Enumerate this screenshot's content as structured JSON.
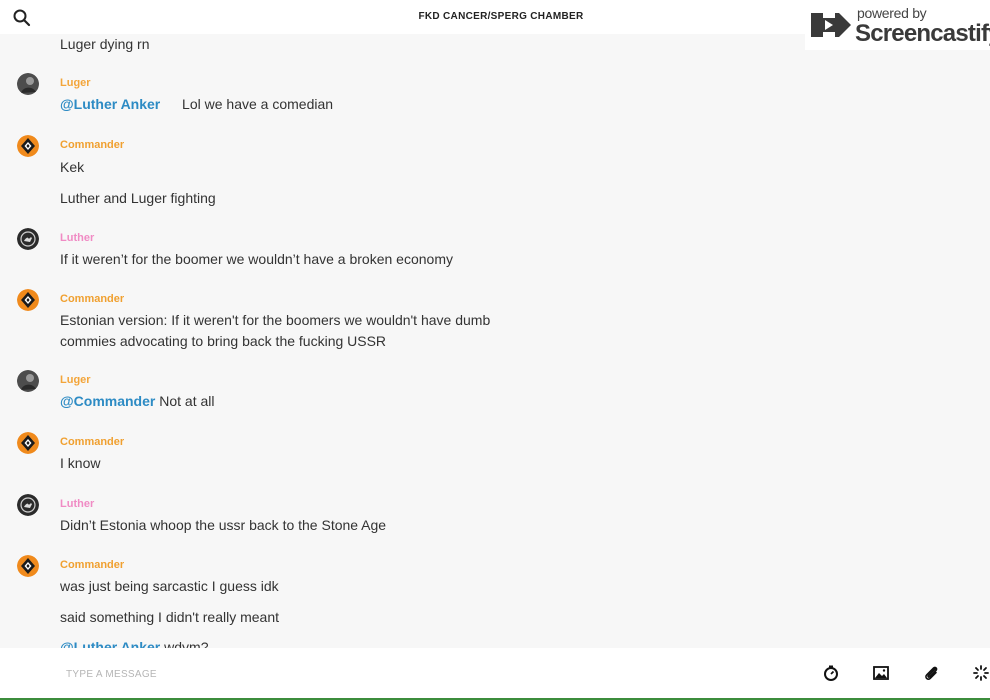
{
  "header": {
    "title": "FKD CANCER/SPERG CHAMBER"
  },
  "watermark": {
    "powered": "powered by",
    "brand": "Screencastify"
  },
  "messages": [
    {
      "author": "",
      "lines": [
        "Luger dying rn"
      ]
    },
    {
      "author": "Luger",
      "mention": "@Luther Anker",
      "lines": [
        "Lol we have a comedian"
      ]
    },
    {
      "author": "Commander",
      "lines": [
        "Kek",
        "Luther and Luger fighting"
      ]
    },
    {
      "author": "Luther",
      "lines": [
        "If it weren’t for the boomer we wouldn’t have a broken economy"
      ]
    },
    {
      "author": "Commander",
      "lines": [
        "Estonian version: If it weren't for the boomers we wouldn't have dumb",
        "commies advocating to bring back the fucking USSR"
      ]
    },
    {
      "author": "Luger",
      "mention": "@Commander",
      "lines": [
        "Not at all"
      ]
    },
    {
      "author": "Commander",
      "lines": [
        "I know"
      ]
    },
    {
      "author": "Luther",
      "lines": [
        "Didn’t Estonia whoop the ussr back to the Stone Age"
      ]
    },
    {
      "author": "Commander",
      "lines": [
        "was just being sarcastic I guess idk",
        "said something I didn't really meant"
      ]
    },
    {
      "author": "",
      "mention": "@Luther Anker",
      "lines": [
        "wdym?"
      ]
    }
  ],
  "composer": {
    "placeholder": "TYPE A MESSAGE"
  },
  "icons": {
    "search": "search-icon",
    "phone": "phone-icon",
    "info": "info-icon",
    "timer": "timer-icon",
    "image": "image-icon",
    "attach": "paperclip-icon",
    "loading": "spinner-icon"
  },
  "colors": {
    "mention": "#2d8bc4",
    "luger": "#f3a53a",
    "commander": "#f0a030",
    "luther": "#f08bc4",
    "commander_avatar": "#f08a1c"
  }
}
